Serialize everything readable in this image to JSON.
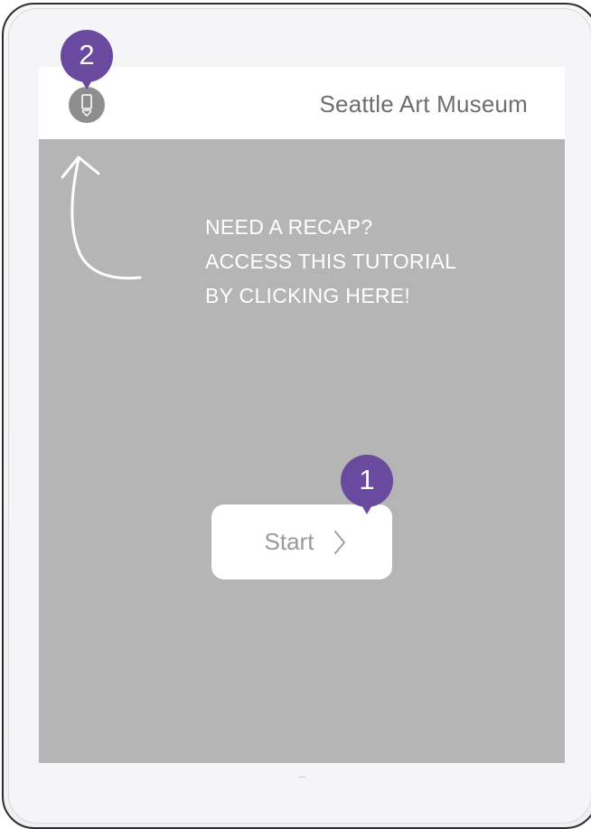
{
  "header": {
    "title": "Seattle Art Museum",
    "menu_icon": "bookmark-icon"
  },
  "hint": {
    "lines": [
      "NEED A RECAP?",
      "ACCESS THIS TUTORIAL",
      "BY CLICKING HERE!"
    ],
    "arrow_icon": "curved-arrow-up-icon"
  },
  "start_button": {
    "label": "Start",
    "icon": "chevron-right-icon"
  },
  "callouts": [
    {
      "number": "1",
      "color": "#6a4a9e"
    },
    {
      "number": "2",
      "color": "#6a4a9e"
    }
  ],
  "colors": {
    "screen_overlay": "#b5b5b5",
    "header_bg": "#ffffff",
    "badge": "#6a4a9e",
    "menu_button": "#8e8e8e"
  }
}
